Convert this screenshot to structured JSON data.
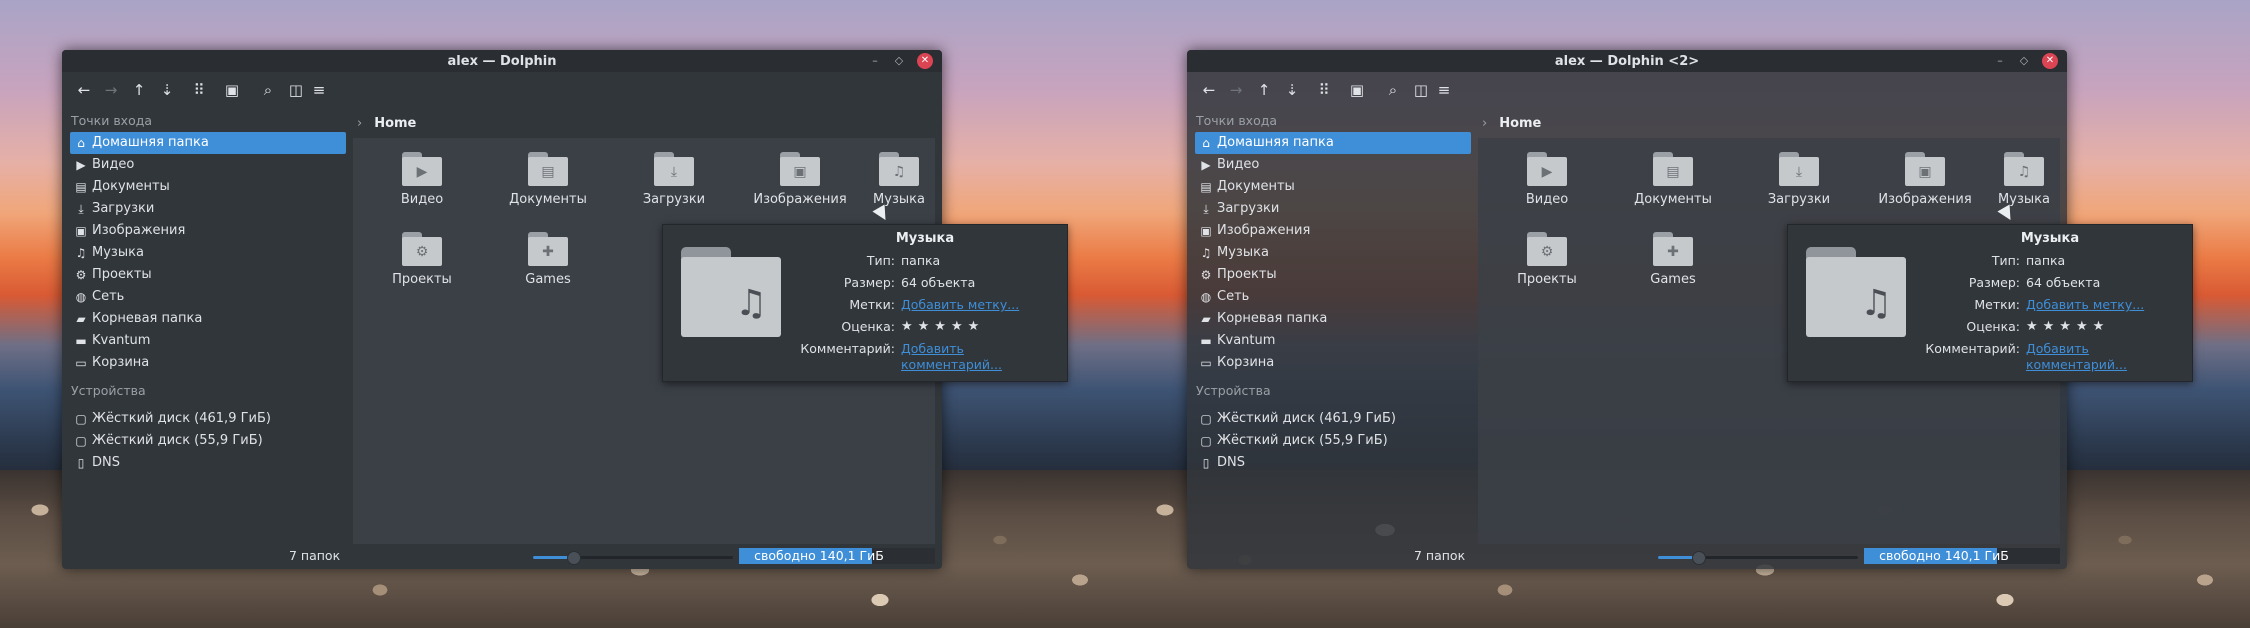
{
  "windows": [
    {
      "title": "alex — Dolphin",
      "breadcrumb": "Home",
      "sidebar": {
        "places_header": "Точки входа",
        "places": [
          {
            "label": "Домашняя папка",
            "icon": "home-icon",
            "glyph": "⌂",
            "selected": true
          },
          {
            "label": "Видео",
            "icon": "video-icon",
            "glyph": "▶"
          },
          {
            "label": "Документы",
            "icon": "document-icon",
            "glyph": "▤"
          },
          {
            "label": "Загрузки",
            "icon": "download-icon",
            "glyph": "⤓"
          },
          {
            "label": "Изображения",
            "icon": "image-icon",
            "glyph": "▣"
          },
          {
            "label": "Музыка",
            "icon": "music-icon",
            "glyph": "♫"
          },
          {
            "label": "Проекты",
            "icon": "gear-icon",
            "glyph": "⚙"
          },
          {
            "label": "Сеть",
            "icon": "network-icon",
            "glyph": "◍"
          },
          {
            "label": "Корневая папка",
            "icon": "root-folder-icon",
            "glyph": "▰"
          },
          {
            "label": "Kvantum",
            "icon": "folder-icon",
            "glyph": "▬"
          },
          {
            "label": "Корзина",
            "icon": "trash-icon",
            "glyph": "▭"
          }
        ],
        "devices_header": "Устройства",
        "devices": [
          {
            "label": "Жёсткий диск (461,9 ГиБ)",
            "icon": "hard-disk-icon",
            "glyph": "▢"
          },
          {
            "label": "Жёсткий диск (55,9 ГиБ)",
            "icon": "hard-disk-icon",
            "glyph": "▢"
          },
          {
            "label": "DNS",
            "icon": "phone-icon",
            "glyph": "▯"
          }
        ]
      },
      "folders": [
        {
          "label": "Видео",
          "emblem": "video-icon",
          "glyph": "▶"
        },
        {
          "label": "Документы",
          "emblem": "document-icon",
          "glyph": "▤"
        },
        {
          "label": "Загрузки",
          "emblem": "download-icon",
          "glyph": "⤓"
        },
        {
          "label": "Изображения",
          "emblem": "image-icon",
          "glyph": "▣"
        },
        {
          "label": "Музыка",
          "emblem": "music-icon",
          "glyph": "♫"
        },
        {
          "label": "Проекты",
          "emblem": "gear-icon",
          "glyph": "⚙"
        },
        {
          "label": "Games",
          "emblem": "gamepad-icon",
          "glyph": "✚"
        }
      ],
      "status": {
        "count": "7 папок",
        "free_space": "свободно 140,1 ГиБ",
        "disk_used_fraction": 0.68,
        "zoom_fraction": 0.2
      },
      "tooltip": {
        "title": "Музыка",
        "rows": [
          {
            "key": "Тип:",
            "value": "папка"
          },
          {
            "key": "Размер:",
            "value": "64 объекта"
          },
          {
            "key": "Метки:",
            "value": "Добавить метку..."
          },
          {
            "key": "Оценка:",
            "value": "★★★★★"
          },
          {
            "key": "Комментарий:",
            "value": "Добавить комментарий..."
          }
        ]
      }
    },
    {
      "title": "alex — Dolphin <2>",
      "breadcrumb": "Home",
      "sidebar": {
        "places_header": "Точки входа",
        "places": [
          {
            "label": "Домашняя папка",
            "icon": "home-icon",
            "glyph": "⌂",
            "selected": true
          },
          {
            "label": "Видео",
            "icon": "video-icon",
            "glyph": "▶"
          },
          {
            "label": "Документы",
            "icon": "document-icon",
            "glyph": "▤"
          },
          {
            "label": "Загрузки",
            "icon": "download-icon",
            "glyph": "⤓"
          },
          {
            "label": "Изображения",
            "icon": "image-icon",
            "glyph": "▣"
          },
          {
            "label": "Музыка",
            "icon": "music-icon",
            "glyph": "♫"
          },
          {
            "label": "Проекты",
            "icon": "gear-icon",
            "glyph": "⚙"
          },
          {
            "label": "Сеть",
            "icon": "network-icon",
            "glyph": "◍"
          },
          {
            "label": "Корневая папка",
            "icon": "root-folder-icon",
            "glyph": "▰"
          },
          {
            "label": "Kvantum",
            "icon": "folder-icon",
            "glyph": "▬"
          },
          {
            "label": "Корзина",
            "icon": "trash-icon",
            "glyph": "▭"
          }
        ],
        "devices_header": "Устройства",
        "devices": [
          {
            "label": "Жёсткий диск (461,9 ГиБ)",
            "icon": "hard-disk-icon",
            "glyph": "▢"
          },
          {
            "label": "Жёсткий диск (55,9 ГиБ)",
            "icon": "hard-disk-icon",
            "glyph": "▢"
          },
          {
            "label": "DNS",
            "icon": "phone-icon",
            "glyph": "▯"
          }
        ]
      },
      "folders": [
        {
          "label": "Видео",
          "emblem": "video-icon",
          "glyph": "▶"
        },
        {
          "label": "Документы",
          "emblem": "document-icon",
          "glyph": "▤"
        },
        {
          "label": "Загрузки",
          "emblem": "download-icon",
          "glyph": "⤓"
        },
        {
          "label": "Изображения",
          "emblem": "image-icon",
          "glyph": "▣"
        },
        {
          "label": "Музыка",
          "emblem": "music-icon",
          "glyph": "♫"
        },
        {
          "label": "Проекты",
          "emblem": "gear-icon",
          "glyph": "⚙"
        },
        {
          "label": "Games",
          "emblem": "gamepad-icon",
          "glyph": "✚"
        }
      ],
      "status": {
        "count": "7 папок",
        "free_space": "свободно 140,1 ГиБ",
        "disk_used_fraction": 0.68,
        "zoom_fraction": 0.2
      },
      "tooltip": {
        "title": "Музыка",
        "rows": [
          {
            "key": "Тип:",
            "value": "папка"
          },
          {
            "key": "Размер:",
            "value": "64 объекта"
          },
          {
            "key": "Метки:",
            "value": "Добавить метку..."
          },
          {
            "key": "Оценка:",
            "value": "★★★★★"
          },
          {
            "key": "Комментарий:",
            "value": "Добавить комментарий..."
          }
        ]
      }
    }
  ],
  "toolbar": [
    {
      "name": "back-icon",
      "glyph": "←",
      "enabled": true
    },
    {
      "name": "forward-icon",
      "glyph": "→",
      "enabled": false
    },
    {
      "name": "up-icon",
      "glyph": "↑",
      "enabled": true
    },
    {
      "name": "sort-icon",
      "glyph": "⇣",
      "enabled": true
    },
    {
      "name": "icon-view-icon",
      "glyph": "⠿",
      "enabled": true
    },
    {
      "name": "preview-icon",
      "glyph": "▣",
      "enabled": true
    },
    {
      "name": "search-icon",
      "glyph": "⌕",
      "enabled": true
    },
    {
      "name": "split-view-icon",
      "glyph": "◫",
      "enabled": true
    },
    {
      "name": "menu-icon",
      "glyph": "≡",
      "enabled": true
    }
  ],
  "window_buttons": {
    "minimize": "–",
    "maximize": "◇",
    "close": "✕"
  },
  "colors": {
    "accent": "#3e8ed8",
    "window_bg": "#31363b",
    "close_button": "#da4453"
  }
}
